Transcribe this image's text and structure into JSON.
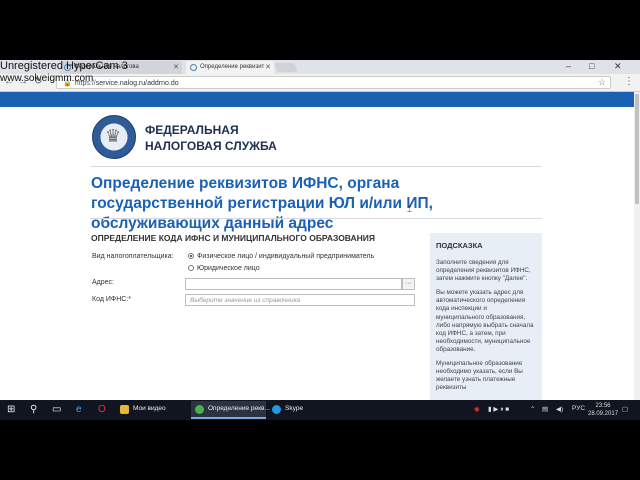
{
  "watermark": {
    "line1": "Unregistered HyperCam 3",
    "line2": "www.solveigmm.com"
  },
  "browser": {
    "tabs": [
      {
        "label": "Федеральная налогова"
      },
      {
        "label": "Определение реквизит"
      }
    ],
    "window_controls": [
      "–",
      "□",
      "✕"
    ],
    "url_host": "https://",
    "url_path": "service.nalog.ru/addrno.do"
  },
  "header": {
    "org_line1": "ФЕДЕРАЛЬНАЯ",
    "org_line2": "НАЛОГОВАЯ СЛУЖБА"
  },
  "page": {
    "title": "Определение реквизитов ИФНС, органа государственной регистрации ЮЛ и/или ИП, обслуживающих данный адрес",
    "section_title": "ОПРЕДЕЛЕНИЕ КОДА ИФНС И МУНИЦИПАЛЬНОГО ОБРАЗОВАНИЯ"
  },
  "form": {
    "taxpayer_label": "Вид налогоплательщика:",
    "option_individual": "Физическое лицо / индивидуальный предприниматель",
    "option_legal": "Юридическое лицо",
    "address_label": "Адрес:",
    "address_value": "",
    "address_button": "···",
    "ifns_label": "Код ИФНС:*",
    "ifns_placeholder": "Выберите значение из справочника"
  },
  "hint": {
    "title": "ПОДСКАЗКА",
    "p1": "Заполните сведения для определения реквизитов ИФНС, затем нажмите кнопку \"Далее\".",
    "p2": "Вы можете указать адрес для автоматического определения кода инспекции и муниципального образования, либо напрямую выбрать сначала код ИФНС, а затем, при необходимости, муниципальное образование.",
    "p3": "Муниципальное образование необходимо указать, если Вы желаете узнать платежные реквизиты"
  },
  "taskbar": {
    "apps": [
      {
        "label": "Мои видео",
        "color": "#e8b53a"
      },
      {
        "label": "Определение рекв...",
        "color": "#4caf50"
      },
      {
        "label": "Skype",
        "color": "#1e9be0"
      }
    ],
    "lang": "РУС",
    "time": "23:56",
    "date": "28.09.2017"
  },
  "colors": {
    "accent": "#1a61b4",
    "hint_bg": "#e7eef6"
  }
}
